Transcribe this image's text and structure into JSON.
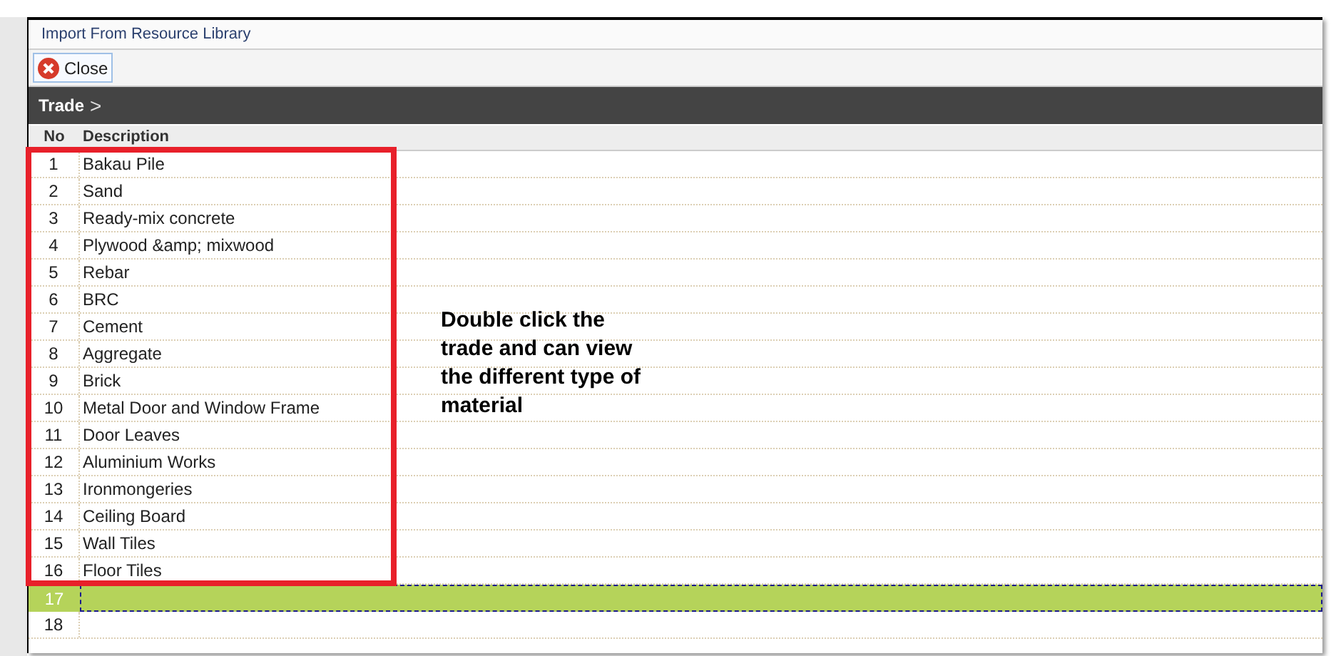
{
  "window": {
    "title": "Import From Resource Library"
  },
  "toolbar": {
    "close_button": "Close"
  },
  "breadcrumb": {
    "label": "Trade",
    "separator": ">"
  },
  "table": {
    "columns": [
      "No",
      "Description"
    ],
    "rows": [
      {
        "no": "1",
        "description": "Bakau Pile",
        "selected": false
      },
      {
        "no": "2",
        "description": "Sand",
        "selected": false
      },
      {
        "no": "3",
        "description": "Ready-mix concrete",
        "selected": false
      },
      {
        "no": "4",
        "description": "Plywood &amp; mixwood",
        "selected": false
      },
      {
        "no": "5",
        "description": "Rebar",
        "selected": false
      },
      {
        "no": "6",
        "description": "BRC",
        "selected": false
      },
      {
        "no": "7",
        "description": "Cement",
        "selected": false
      },
      {
        "no": "8",
        "description": "Aggregate",
        "selected": false
      },
      {
        "no": "9",
        "description": "Brick",
        "selected": false
      },
      {
        "no": "10",
        "description": "Metal Door and Window Frame",
        "selected": false
      },
      {
        "no": "11",
        "description": "Door Leaves",
        "selected": false
      },
      {
        "no": "12",
        "description": "Aluminium Works",
        "selected": false
      },
      {
        "no": "13",
        "description": "Ironmongeries",
        "selected": false
      },
      {
        "no": "14",
        "description": "Ceiling Board",
        "selected": false
      },
      {
        "no": "15",
        "description": "Wall Tiles",
        "selected": false
      },
      {
        "no": "16",
        "description": "Floor Tiles",
        "selected": false
      },
      {
        "no": "17",
        "selected": true
      },
      {
        "no": "18",
        "selected": false
      }
    ]
  },
  "annotation": {
    "text": "Double click the trade and can view the different type of material"
  }
}
